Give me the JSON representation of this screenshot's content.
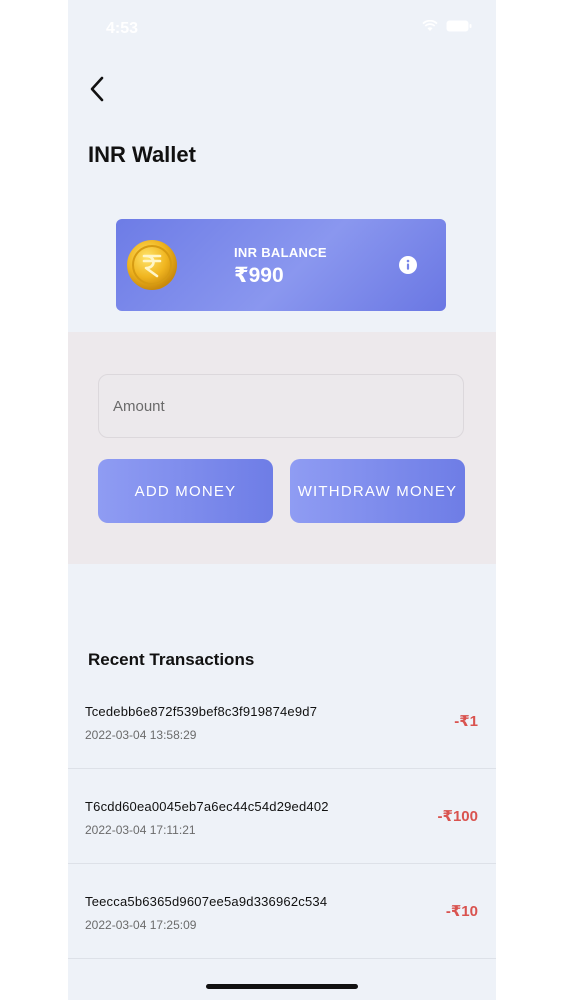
{
  "status_bar": {
    "time": "4:53"
  },
  "header": {
    "title": "INR Wallet"
  },
  "balance": {
    "label": "INR BALANCE",
    "value": "₹990"
  },
  "form": {
    "amount_placeholder": "Amount",
    "add_label": "ADD MONEY",
    "withdraw_label": "WITHDRAW MONEY"
  },
  "transactions": {
    "title": "Recent Transactions",
    "items": [
      {
        "id": "Tcedebb6e872f539bef8c3f919874e9d7",
        "date": "2022-03-04 13:58:29",
        "amount": "-₹1"
      },
      {
        "id": "T6cdd60ea0045eb7a6ec44c54d29ed402",
        "date": "2022-03-04 17:11:21",
        "amount": "-₹100"
      },
      {
        "id": "Teecca5b6365d9607ee5a9d336962c534",
        "date": "2022-03-04 17:25:09",
        "amount": "-₹10"
      }
    ]
  },
  "colors": {
    "accent": "#6e7de6",
    "negative": "#d9534f",
    "background": "#eef2f8"
  },
  "icons": [
    "back-arrow-icon",
    "rupee-coin-icon",
    "info-icon",
    "wifi-icon",
    "battery-icon"
  ]
}
